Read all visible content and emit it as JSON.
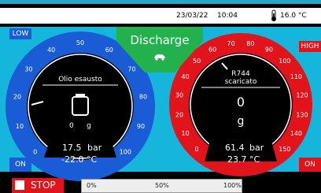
{
  "header": {
    "date": "23/03/22",
    "time": "10:04",
    "temperature": "16.0 °C",
    "thermometer_icon": "thermometer-icon"
  },
  "left_panel": {
    "low_label": "LOW",
    "on_label": "ON",
    "title": "Olio esausto",
    "bottle_icon": "oil-bottle-icon",
    "weight": "0",
    "weight_unit": "g",
    "pressure": "17.5",
    "pressure_unit": "bar",
    "temperature": "-22.0 °C",
    "dial_ticks": [
      "0",
      "10",
      "20",
      "30",
      "40",
      "50",
      "60",
      "70",
      "80",
      "90",
      "100"
    ],
    "dial_color": "#1a5cd6"
  },
  "center": {
    "title": "Discharge",
    "icon": "car-icon",
    "color": "#22b14c"
  },
  "right_panel": {
    "high_label": "HIGH",
    "on_label": "ON",
    "title_line1": "R744",
    "title_line2": "scaricato",
    "weight": "0",
    "weight_unit": "g",
    "pressure": "61.4",
    "pressure_unit": "bar",
    "temperature": "23.7 °C",
    "dial_ticks": [
      "0",
      "10",
      "20",
      "30",
      "40",
      "50",
      "60",
      "70",
      "80",
      "90",
      "100",
      "110",
      "120",
      "130",
      "140",
      "150"
    ],
    "dial_color": "#e0141a"
  },
  "bottom": {
    "stop_label": "STOP",
    "progress_labels": [
      "0%",
      "50%",
      "100%"
    ],
    "progress_value_fraction": 0
  }
}
